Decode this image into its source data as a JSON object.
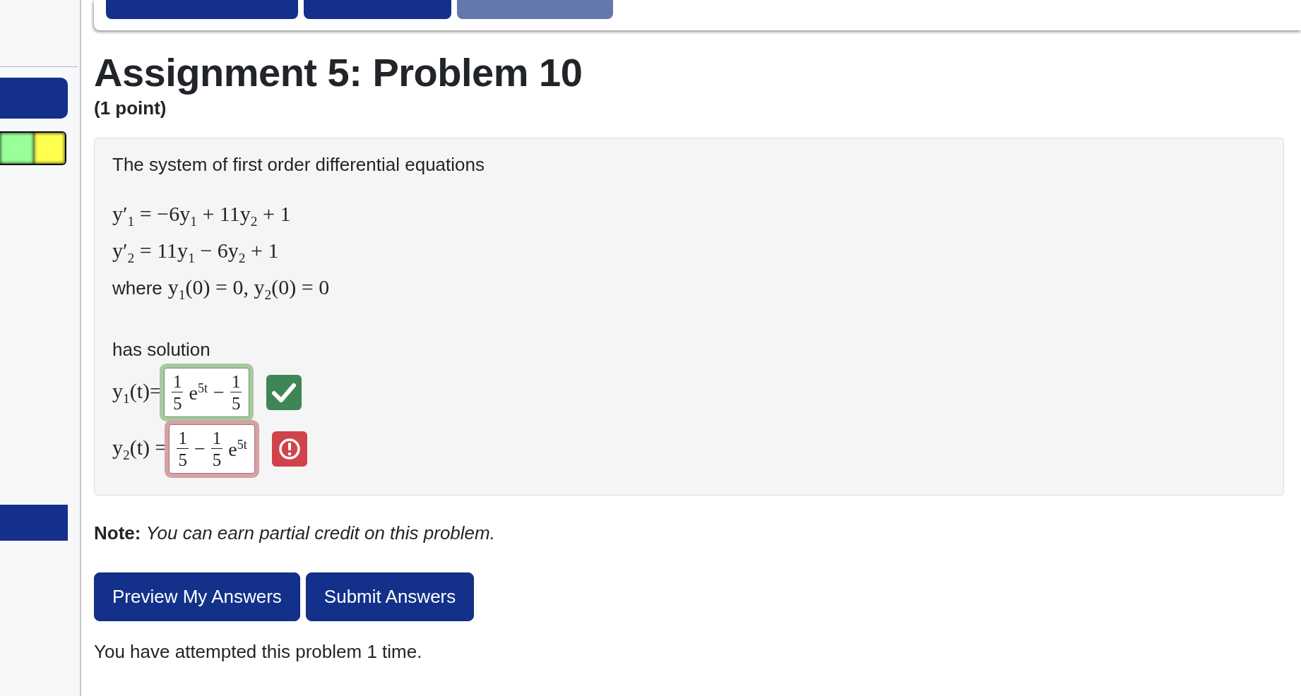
{
  "nav": {
    "buttons": [
      {
        "disabled": false
      },
      {
        "disabled": false
      },
      {
        "disabled": true
      }
    ]
  },
  "sidebar": {
    "items": [
      {
        "kind": "button"
      },
      {
        "kind": "progress",
        "segments": [
          {
            "color": "#99ff99"
          },
          {
            "color": "#ffff4d"
          }
        ]
      },
      {
        "kind": "bar"
      }
    ]
  },
  "title": "Assignment 5: Problem 10",
  "points": "(1 point)",
  "problem": {
    "intro": "The system of first order differential equations",
    "equations": [
      "y′$_{1}$ = −6y$_{1}$ + 11y$_{2}$ + 1",
      "y′$_{2}$ = 11y$_{1}$ − 6y$_{2}$ + 1"
    ],
    "condition_label": "where",
    "condition": "y$_{1}$(0) = 0, y$_{2}$(0) = 0",
    "solution_label": "has solution",
    "answers": [
      {
        "label": "y$_{1}$(t)=",
        "correct": true,
        "terms": [
          {
            "kind": "frac",
            "num": "1",
            "den": "5"
          },
          {
            "kind": "text",
            "text": "e$^{5t}$"
          },
          {
            "kind": "text",
            "text": "−"
          },
          {
            "kind": "frac",
            "num": "1",
            "den": "5"
          }
        ]
      },
      {
        "label": "y$_{2}$(t) =",
        "correct": false,
        "terms": [
          {
            "kind": "frac",
            "num": "1",
            "den": "5"
          },
          {
            "kind": "text",
            "text": "−"
          },
          {
            "kind": "frac",
            "num": "1",
            "den": "5"
          },
          {
            "kind": "text",
            "text": "e$^{5t}$"
          }
        ]
      }
    ]
  },
  "note": {
    "label": "Note:",
    "text": "You can earn partial credit on this problem."
  },
  "actions": [
    "Preview My Answers",
    "Submit Answers"
  ],
  "attempts": "You have attempted this problem 1 time."
}
